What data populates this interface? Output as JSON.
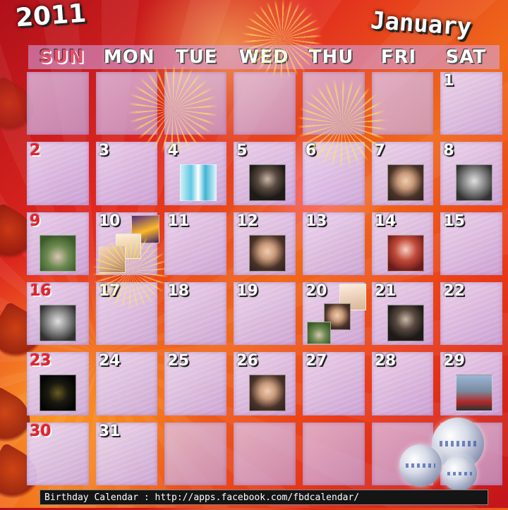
{
  "header": {
    "year": "2011",
    "month": "January"
  },
  "weekdays": [
    "SUN",
    "MON",
    "TUE",
    "WED",
    "THU",
    "FRI",
    "SAT"
  ],
  "days": [
    "",
    "",
    "",
    "",
    "",
    "",
    "1",
    "2",
    "3",
    "4",
    "5",
    "6",
    "7",
    "8",
    "9",
    "10",
    "11",
    "12",
    "13",
    "14",
    "15",
    "16",
    "17",
    "18",
    "19",
    "20",
    "21",
    "22",
    "23",
    "24",
    "25",
    "26",
    "27",
    "28",
    "29",
    "30",
    "31",
    "",
    "",
    "",
    "",
    ""
  ],
  "footer": {
    "text": "Birthday Calendar : http://apps.facebook.com/fbdcalendar/"
  },
  "colors": {
    "sunday_number": "#e8202a",
    "day_number": "#ffffff",
    "cell_fill": "#dcc8f0",
    "grid_lines": "#c8201c"
  }
}
